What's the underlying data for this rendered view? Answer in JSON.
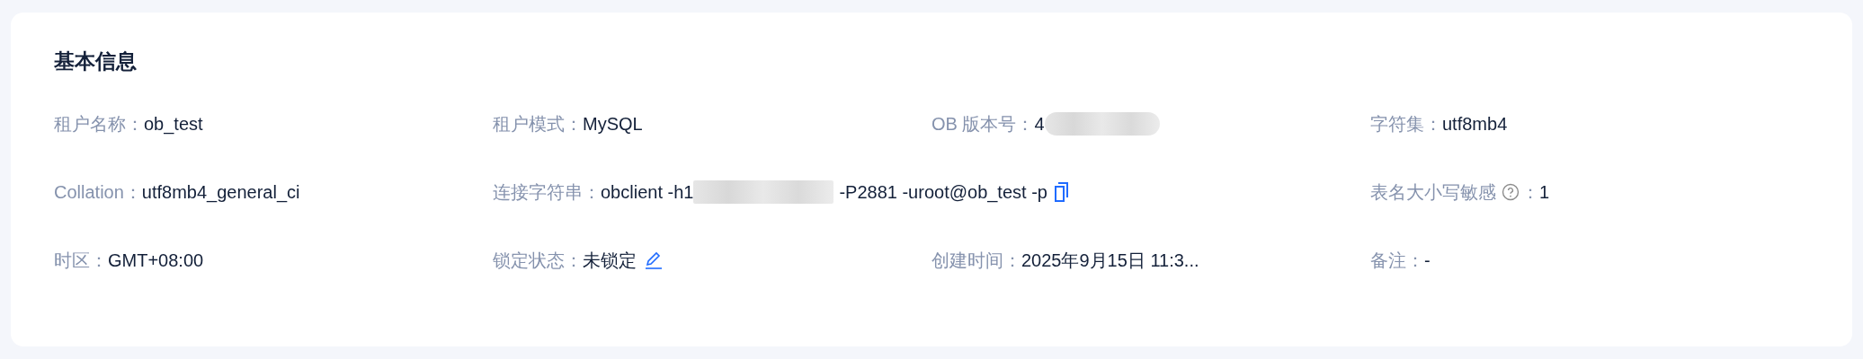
{
  "card": {
    "title": "基本信息",
    "items": [
      {
        "kind": "text",
        "label": "租户名称：",
        "value": "ob_test"
      },
      {
        "kind": "text",
        "label": "租户模式：",
        "value": "MySQL"
      },
      {
        "kind": "redacted",
        "label": "OB 版本号：",
        "value": "4"
      },
      {
        "kind": "text",
        "label": "字符集：",
        "value": "utf8mb4"
      },
      {
        "kind": "text",
        "label": "Collation：",
        "value": "utf8mb4_general_ci"
      },
      {
        "kind": "connection",
        "label": "连接字符串：",
        "value": "obclient -h1",
        "value_after": "-P2881 -uroot@ob_test -p"
      },
      {
        "kind": "help",
        "label": "表名大小写敏感",
        "colon": "：",
        "value": "1"
      },
      {
        "kind": "text",
        "label": "时区：",
        "value": "GMT+08:00"
      },
      {
        "kind": "editable",
        "label": "锁定状态：",
        "value": "未锁定"
      },
      {
        "kind": "text",
        "label": "创建时间：",
        "value": "2025年9月15日 11:3..."
      },
      {
        "kind": "text",
        "label": "备注：",
        "value": "-"
      }
    ]
  }
}
